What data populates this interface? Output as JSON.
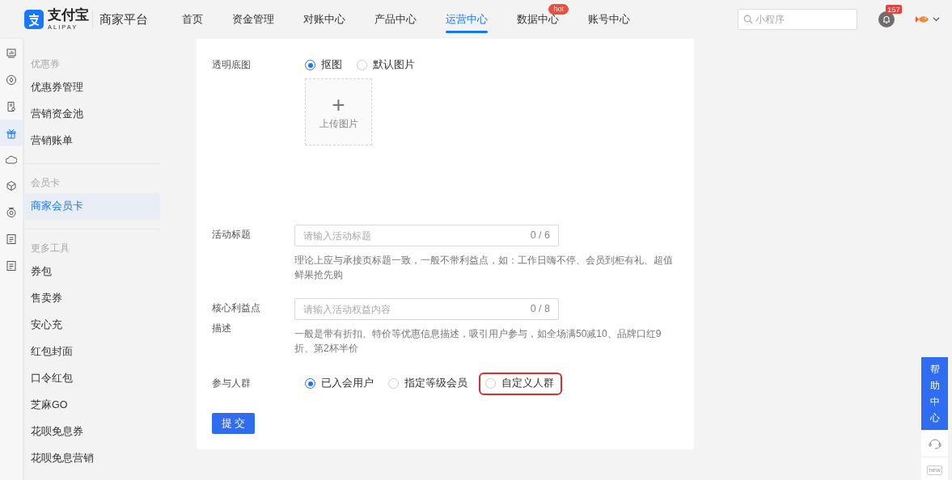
{
  "header": {
    "logo": {
      "name": "支付宝",
      "sub": "ALIPAY"
    },
    "platform": "商家平台",
    "nav": [
      {
        "label": "首页",
        "selected": false
      },
      {
        "label": "资金管理",
        "selected": false
      },
      {
        "label": "对账中心",
        "selected": false
      },
      {
        "label": "产品中心",
        "selected": false
      },
      {
        "label": "运营中心",
        "selected": true
      },
      {
        "label": "数据中心",
        "selected": false,
        "badge": "hot"
      },
      {
        "label": "账号中心",
        "selected": false
      }
    ],
    "search": {
      "placeholder": "小程序"
    },
    "notifications": "157"
  },
  "rail": [
    {
      "kind": "monitor",
      "selected": false
    },
    {
      "kind": "compass",
      "selected": false
    },
    {
      "kind": "doc",
      "selected": false
    },
    {
      "kind": "gift",
      "selected": true
    },
    {
      "kind": "cloud",
      "selected": false
    },
    {
      "kind": "cube",
      "selected": false
    },
    {
      "kind": "badge",
      "selected": false
    },
    {
      "kind": "list",
      "selected": false
    },
    {
      "kind": "list",
      "selected": false
    }
  ],
  "sidebar": [
    {
      "heading": "优惠券",
      "items": [
        {
          "label": "优惠券管理",
          "selected": false
        },
        {
          "label": "营销资金池",
          "selected": false
        },
        {
          "label": "营销账单",
          "selected": false
        }
      ]
    },
    {
      "heading": "会员卡",
      "items": [
        {
          "label": "商家会员卡",
          "selected": true
        }
      ]
    },
    {
      "heading": "更多工具",
      "items": [
        {
          "label": "券包",
          "selected": false
        },
        {
          "label": "售卖券",
          "selected": false
        },
        {
          "label": "安心充",
          "selected": false
        },
        {
          "label": "红包封面",
          "selected": false
        },
        {
          "label": "口令红包",
          "selected": false
        },
        {
          "label": "芝麻GO",
          "selected": false
        },
        {
          "label": "花呗免息券",
          "selected": false
        },
        {
          "label": "花呗免息营销",
          "selected": false
        }
      ]
    }
  ],
  "form": [
    {
      "kind": "radio-upload",
      "label": "透明底图",
      "options": [
        {
          "label": "抠图",
          "selected": true,
          "highlighted": false
        },
        {
          "label": "默认图片",
          "selected": false,
          "highlighted": false
        }
      ],
      "upload": {
        "label": "上传图片",
        "icon": "+"
      }
    },
    {
      "kind": "input",
      "label": "活动标题",
      "placeholder": "请输入活动标题",
      "counter": "0 / 6",
      "help": "理论上应与承接页标题一致，一般不带利益点，如：工作日嗨不停、会员到柜有礼、超值鲜果抢先购"
    },
    {
      "kind": "input",
      "label": "核心利益点描述",
      "placeholder": "请输入活动权益内容",
      "counter": "0 / 8",
      "help": "一般是带有折扣、特价等优惠信息描述，吸引用户参与，如全场满50减10、品牌口红9折、第2杯半价"
    },
    {
      "kind": "radio",
      "label": "参与人群",
      "options": [
        {
          "label": "已入会用户",
          "selected": true,
          "highlighted": false
        },
        {
          "label": "指定等级会员",
          "selected": false,
          "highlighted": false
        },
        {
          "label": "自定义人群",
          "selected": false,
          "highlighted": true
        }
      ]
    }
  ],
  "submit": "提 交",
  "help_panel": {
    "label": "帮助中心",
    "new_label": "new"
  }
}
